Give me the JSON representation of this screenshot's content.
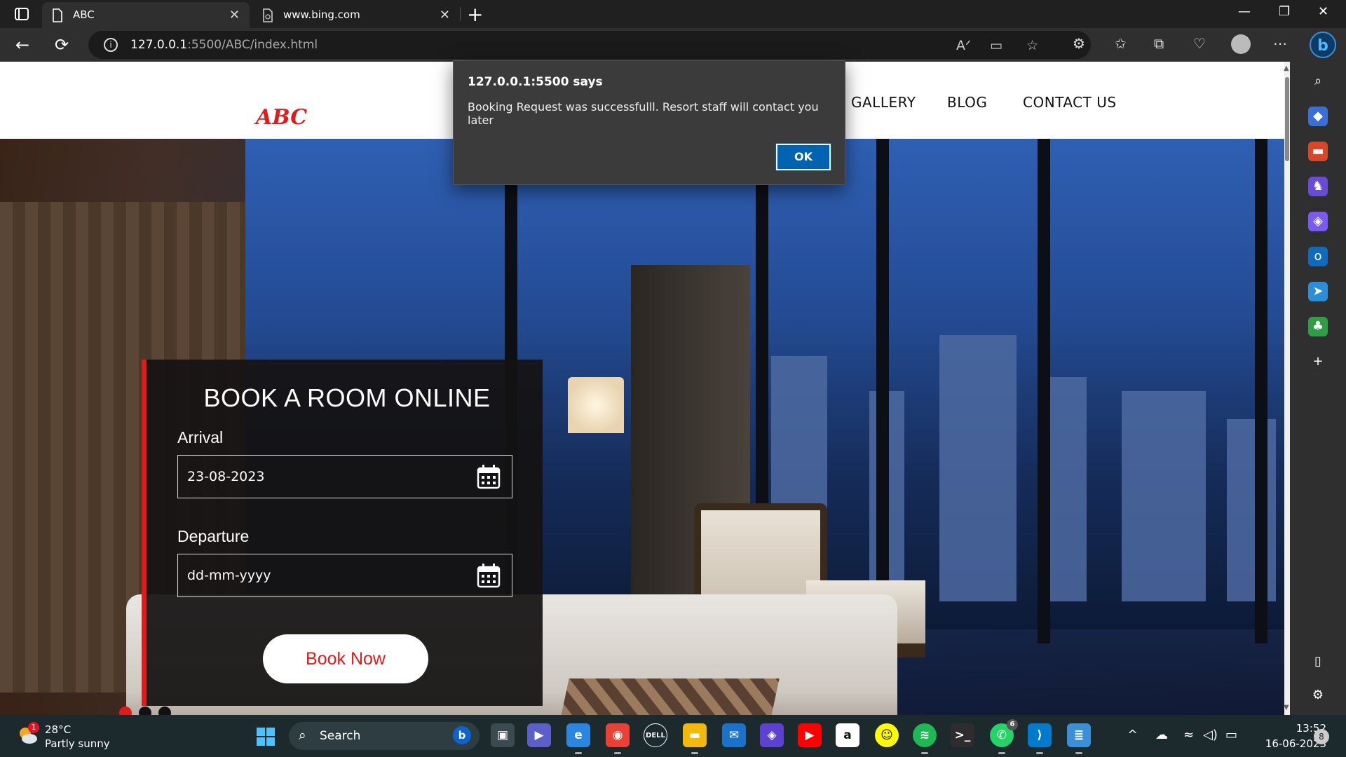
{
  "browser": {
    "tabs": [
      {
        "title": "ABC",
        "active": true
      },
      {
        "title": "www.bing.com",
        "active": false
      }
    ],
    "url_host": "127.0.0.1",
    "url_path": ":5500/ABC/index.html"
  },
  "site": {
    "logo": "ABC",
    "nav": [
      "GALLERY",
      "BLOG",
      "CONTACT US"
    ]
  },
  "booking": {
    "title": "BOOK A ROOM ONLINE",
    "arrival_label": "Arrival",
    "arrival_value": "23-08-2023",
    "departure_label": "Departure",
    "departure_placeholder": "dd-mm-yyyy",
    "button_label": "Book Now"
  },
  "dialog": {
    "title": "127.0.0.1:5500 says",
    "message": "Booking Request was successfulll. Resort staff will contact you later",
    "ok_label": "OK"
  },
  "taskbar": {
    "weather_temp": "28°C",
    "weather_desc": "Partly sunny",
    "weather_badge": "1",
    "search_label": "Search",
    "search_icon": "search-icon",
    "whatsapp_badge": "6",
    "time": "13:52",
    "date": "16-06-2023",
    "notification_count": "8"
  },
  "colors": {
    "accent_red": "#e01b1b",
    "dialog_ok_blue": "#0063b1",
    "taskbar_bg": "#1c2a2e"
  }
}
